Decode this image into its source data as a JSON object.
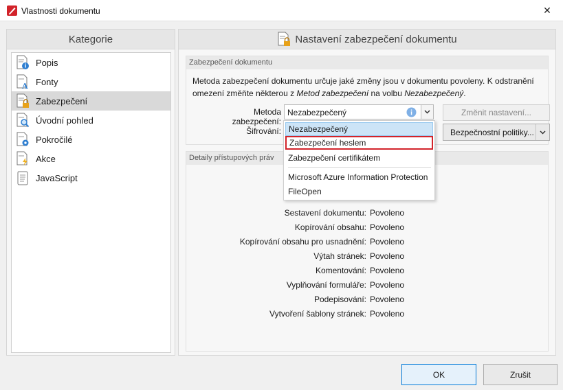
{
  "window": {
    "title": "Vlastnosti dokumentu",
    "close_glyph": "✕",
    "app_icon": "pdf-pen-icon",
    "accent": "#d2232a"
  },
  "categories": {
    "header": "Kategorie",
    "items": [
      {
        "label": "Popis",
        "icon": "doc-info-icon"
      },
      {
        "label": "Fonty",
        "icon": "doc-font-icon"
      },
      {
        "label": "Zabezpečení",
        "icon": "doc-lock-icon",
        "selected": true
      },
      {
        "label": "Úvodní pohled",
        "icon": "doc-view-icon"
      },
      {
        "label": "Pokročilé",
        "icon": "doc-gear-icon"
      },
      {
        "label": "Akce",
        "icon": "doc-lightning-icon"
      },
      {
        "label": "JavaScript",
        "icon": "doc-script-icon"
      }
    ]
  },
  "security": {
    "header": "Nastavení zabezpečení dokumentu",
    "group_title": "Zabezpečení dokumentu",
    "desc_part1": "Metoda zabezpečení dokumentu určuje jaké změny jsou v dokumentu povoleny. K odstranění omezení změňte některou z ",
    "desc_em1": "Metod zabezpečení",
    "desc_part2": " na volbu ",
    "desc_em2": "Nezabezpečený",
    "desc_part3": ".",
    "method_label": "Metoda zabezpečení:",
    "method_value": "Nezabezpečený",
    "change_button": "Změnit nastavení...",
    "encryption_label": "Šifrování:",
    "policy_button": "Bezpečnostní politiky...",
    "dropdown_glyph": "⌄"
  },
  "dropdown": {
    "options": [
      "Nezabezpečený",
      "Zabezpečení heslem",
      "Zabezpečení certifikátem",
      "Microsoft Azure Information Protection",
      "FileOpen"
    ],
    "selected_index": 0,
    "hover_index": 1
  },
  "permissions": {
    "group_title": "Detaily přístupových práv",
    "rows": [
      {
        "key": "Sestavení dokumentu:",
        "value": "Povoleno"
      },
      {
        "key": "Kopírování obsahu:",
        "value": "Povoleno"
      },
      {
        "key": "Kopírování obsahu pro usnadnění:",
        "value": "Povoleno"
      },
      {
        "key": "Výtah stránek:",
        "value": "Povoleno"
      },
      {
        "key": "Komentování:",
        "value": "Povoleno"
      },
      {
        "key": "Vyplňování formuláře:",
        "value": "Povoleno"
      },
      {
        "key": "Podepisování:",
        "value": "Povoleno"
      },
      {
        "key": "Vytvoření šablony stránek:",
        "value": "Povoleno"
      }
    ]
  },
  "footer": {
    "ok": "OK",
    "cancel": "Zrušit"
  }
}
